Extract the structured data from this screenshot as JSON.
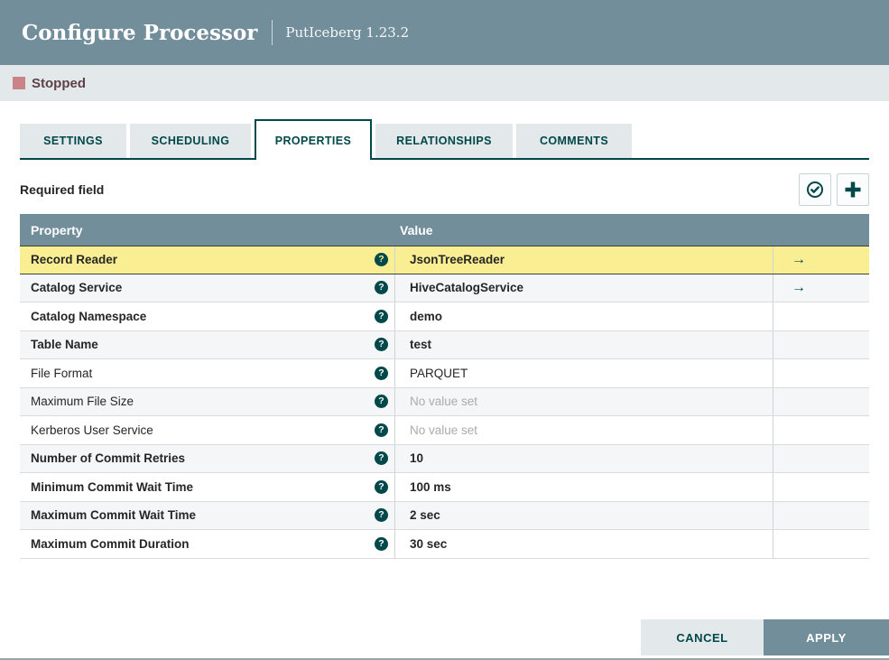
{
  "dialog": {
    "title": "Configure Processor",
    "processor": "PutIceberg 1.23.2"
  },
  "status": {
    "label": "Stopped"
  },
  "tabs": [
    {
      "label": "SETTINGS",
      "active": false
    },
    {
      "label": "SCHEDULING",
      "active": false
    },
    {
      "label": "PROPERTIES",
      "active": true
    },
    {
      "label": "RELATIONSHIPS",
      "active": false
    },
    {
      "label": "COMMENTS",
      "active": false
    }
  ],
  "panel": {
    "required_hint": "Required field"
  },
  "table": {
    "columns": [
      "Property",
      "Value"
    ],
    "rows": [
      {
        "property": "Record Reader",
        "value": "JsonTreeReader",
        "required": true,
        "selected": true,
        "goto": true
      },
      {
        "property": "Catalog Service",
        "value": "HiveCatalogService",
        "required": true,
        "goto": true
      },
      {
        "property": "Catalog Namespace",
        "value": "demo",
        "required": true
      },
      {
        "property": "Table Name",
        "value": "test",
        "required": true
      },
      {
        "property": "File Format",
        "value": "PARQUET"
      },
      {
        "property": "Maximum File Size",
        "value": "No value set",
        "unset": true
      },
      {
        "property": "Kerberos User Service",
        "value": "No value set",
        "unset": true
      },
      {
        "property": "Number of Commit Retries",
        "value": "10",
        "required": true
      },
      {
        "property": "Minimum Commit Wait Time",
        "value": "100 ms",
        "required": true
      },
      {
        "property": "Maximum Commit Wait Time",
        "value": "2 sec",
        "required": true
      },
      {
        "property": "Maximum Commit Duration",
        "value": "30 sec",
        "required": true
      }
    ]
  },
  "icons": {
    "help_glyph": "?",
    "goto_glyph": "→"
  },
  "footer": {
    "cancel_label": "CANCEL",
    "apply_label": "APPLY"
  },
  "colors": {
    "header_bg": "#728E9B",
    "accent": "#004849",
    "bar_bg": "#E3E8EB",
    "selected_row": "#F9EE91",
    "striped_row": "#F4F6F7",
    "stopped_icon": "#CA8487",
    "stopped_text": "#5E4146"
  }
}
